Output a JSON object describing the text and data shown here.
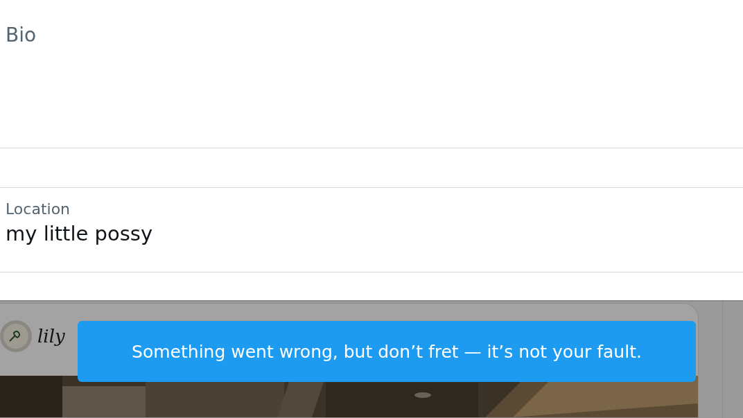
{
  "bio_field": {
    "label": "Bio"
  },
  "location_field": {
    "label": "Location",
    "value": "my little possy"
  },
  "post_card": {
    "author": "lily"
  },
  "toast": {
    "message": "Something went wrong, but don’t fret — it’s not your fault."
  }
}
